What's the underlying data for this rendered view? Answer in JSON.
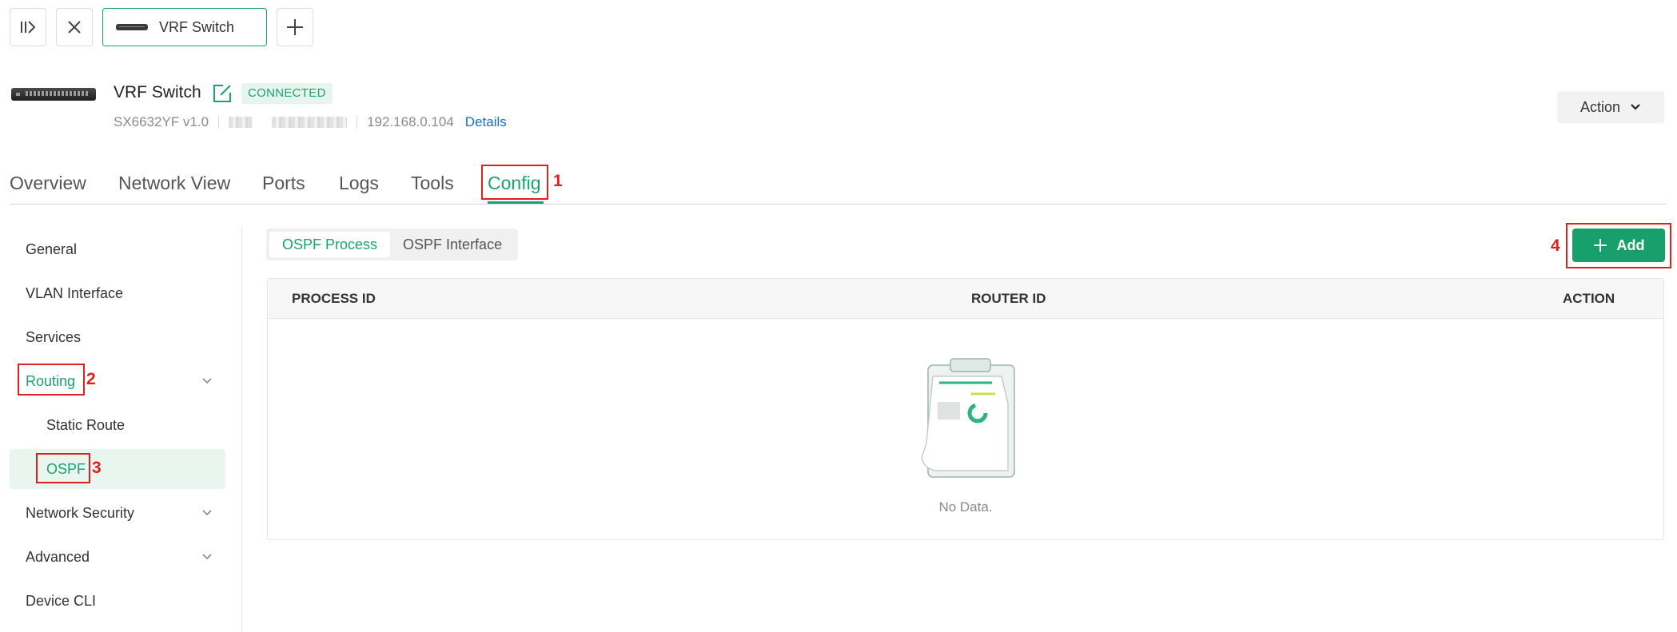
{
  "topbar": {
    "device_tab_label": "VRF Switch",
    "icons": [
      "sidebar-expand-icon",
      "close-icon",
      "plus-icon"
    ]
  },
  "device": {
    "name": "VRF Switch",
    "status": "CONNECTED",
    "model": "SX6632YF v1.0",
    "ip": "192.168.0.104",
    "details_link": "Details"
  },
  "action_button": {
    "label": "Action"
  },
  "nav_tabs": [
    "Overview",
    "Network View",
    "Ports",
    "Logs",
    "Tools",
    "Config"
  ],
  "active_nav_tab": "Config",
  "sidebar": {
    "items": [
      {
        "label": "General"
      },
      {
        "label": "VLAN Interface"
      },
      {
        "label": "Services"
      },
      {
        "label": "Routing",
        "expanded": true
      },
      {
        "label": "Static Route"
      },
      {
        "label": "OSPF",
        "active": true
      },
      {
        "label": "Network Security"
      },
      {
        "label": "Advanced"
      },
      {
        "label": "Device CLI"
      }
    ]
  },
  "content": {
    "segment_tabs": [
      "OSPF Process",
      "OSPF Interface"
    ],
    "active_segment": "OSPF Process",
    "add_button": "Add",
    "table": {
      "columns": [
        "PROCESS ID",
        "ROUTER ID",
        "ACTION"
      ],
      "rows": [],
      "empty_text": "No Data."
    }
  },
  "annotations": [
    "1",
    "2",
    "3",
    "4"
  ],
  "colors": {
    "accent": "#1aa36f",
    "annotation": "#e02020"
  }
}
